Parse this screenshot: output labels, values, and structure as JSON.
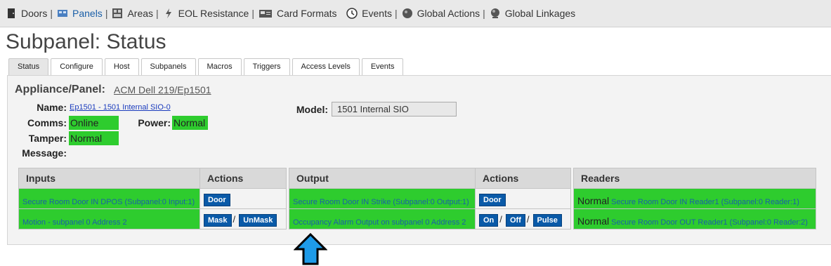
{
  "nav": [
    {
      "label": "Doors",
      "icon": "door-icon",
      "active": false
    },
    {
      "label": "Panels",
      "icon": "panels-icon",
      "active": true
    },
    {
      "label": "Areas",
      "icon": "areas-icon",
      "active": false
    },
    {
      "label": "EOL Resistance",
      "icon": "resistor-icon",
      "active": false
    },
    {
      "label": "Card Formats",
      "icon": "card-format-icon",
      "active": false
    },
    {
      "label": "Events",
      "icon": "clock-icon",
      "active": false
    },
    {
      "label": "Global Actions",
      "icon": "globe-action-icon",
      "active": false
    },
    {
      "label": "Global Linkages",
      "icon": "globe-linkage-icon",
      "active": false
    }
  ],
  "page_title": "Subpanel: Status",
  "tabs": [
    "Status",
    "Configure",
    "Host",
    "Subpanels",
    "Macros",
    "Triggers",
    "Access Levels",
    "Events"
  ],
  "active_tab": "Status",
  "appliance": {
    "label": "Appliance/Panel:",
    "value": "ACM Dell 219/Ep1501"
  },
  "fields": {
    "name_label": "Name:",
    "name_value": "Ep1501 - 1501 Internal SIO-0",
    "comms_label": "Comms:",
    "comms_value": "Online",
    "power_label": "Power:",
    "power_value": "Normal",
    "tamper_label": "Tamper:",
    "tamper_value": "Normal",
    "message_label": "Message:",
    "model_label": "Model:",
    "model_value": "1501 Internal SIO"
  },
  "inputs_table": {
    "headers": [
      "Inputs",
      "Actions"
    ],
    "rows": [
      {
        "name": "Secure Room Door IN DPOS (Subpanel:0 Input:1)",
        "buttons": [
          "Door"
        ]
      },
      {
        "name": "Motion - subpanel 0 Address 2",
        "buttons": [
          "Mask",
          "UnMask"
        ]
      }
    ]
  },
  "output_table": {
    "headers": [
      "Output",
      "Actions"
    ],
    "rows": [
      {
        "name": "Secure Room Door IN Strike (Subpanel:0 Output:1)",
        "buttons": [
          "Door"
        ]
      },
      {
        "name": "Occupancy Alarm Output on subpanel 0 Address 2",
        "buttons": [
          "On",
          "Off",
          "Pulse"
        ]
      }
    ]
  },
  "readers_table": {
    "headers": [
      "Readers"
    ],
    "rows": [
      {
        "status": "Normal",
        "name": "Secure Room Door IN Reader1 (Subpanel:0 Reader:1)"
      },
      {
        "status": "Normal",
        "name": "Secure Room Door OUT Reader1 (Subpanel:0 Reader:2)"
      }
    ]
  },
  "colors": {
    "ok_green": "#2ecc2e",
    "button_blue": "#0a5aa8",
    "arrow_blue": "#1e9be8"
  },
  "annotation_arrow": "up-arrow-icon"
}
